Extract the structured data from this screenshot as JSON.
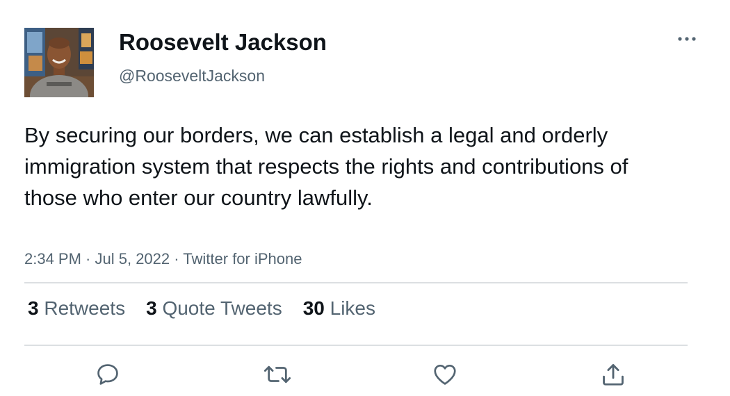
{
  "user": {
    "name": "Roosevelt Jackson",
    "handle": "@RooseveltJackson"
  },
  "tweet": {
    "text": "By securing our borders, we can establish a legal and orderly immigration system that respects the rights and contributions of those who enter our country lawfully.",
    "time": "2:34 PM",
    "date": "Jul 5, 2022",
    "source": "Twitter for iPhone",
    "separator": " · "
  },
  "stats": {
    "retweets_count": "3",
    "retweets_label": "Retweets",
    "quotes_count": "3",
    "quotes_label": "Quote Tweets",
    "likes_count": "30",
    "likes_label": "Likes"
  },
  "icons": {
    "more": "more-horizontal-icon",
    "reply": "speech-bubble-icon",
    "retweet": "retweet-arrows-icon",
    "like": "heart-icon",
    "share": "share-upload-icon"
  },
  "colors": {
    "text_primary": "#0f1419",
    "text_secondary": "#536471",
    "divider": "#dcdfe2",
    "icon": "#536471"
  }
}
